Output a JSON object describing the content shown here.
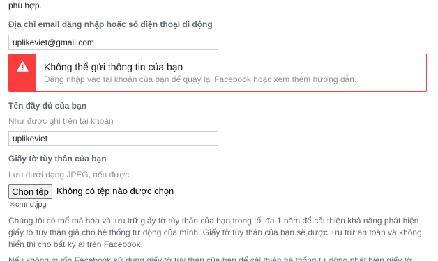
{
  "intro_tail": "phù hợp.",
  "email_field": {
    "label": "Địa chỉ email đăng nhập hoặc số điện thoại di động",
    "value": "uplikeviet@gmail.com"
  },
  "error": {
    "icon": "warning-icon",
    "title": "Không thể gửi thông tin của bạn",
    "message": "Đăng nhập vào tài khoản của bạn để quay lại Facebook hoặc xem thêm hướng dẫn."
  },
  "name_field": {
    "label": "Tên đầy đủ của bạn",
    "helper": "Như được ghi trên tài khoản",
    "value": "uplikeviet"
  },
  "id_document": {
    "label": "Giấy tờ tùy thân của bạn",
    "helper": "Lưu dưới dạng JPEG, nếu được",
    "choose_button": "Chọn tệp",
    "no_file_text": "Không có tệp nào được chọn",
    "remove_icon": "close-icon",
    "attached_file": "cmnd.jpg"
  },
  "privacy_note": "Chúng tôi có thể mã hóa và lưu trữ giấy tờ tùy thân của bạn trong tối đa 1 năm để cải thiện khả năng phát hiện giấy tờ tùy thân giả cho hệ thống tự động của mình. Giấy tờ tùy thân của bạn sẽ được lưu trữ an toàn và không hiển thị cho bất kỳ ai trên Facebook.",
  "next_paragraph_partial": "Nếu không muốn Facebook sử dụng giấy tờ tùy thân của bạn để cải thiện hệ thống tự động phát hiện giấy tờ",
  "colors": {
    "error": "#fa3e3e",
    "label": "#606770",
    "helper": "#90949c",
    "input_border": "#ccd0d5"
  }
}
